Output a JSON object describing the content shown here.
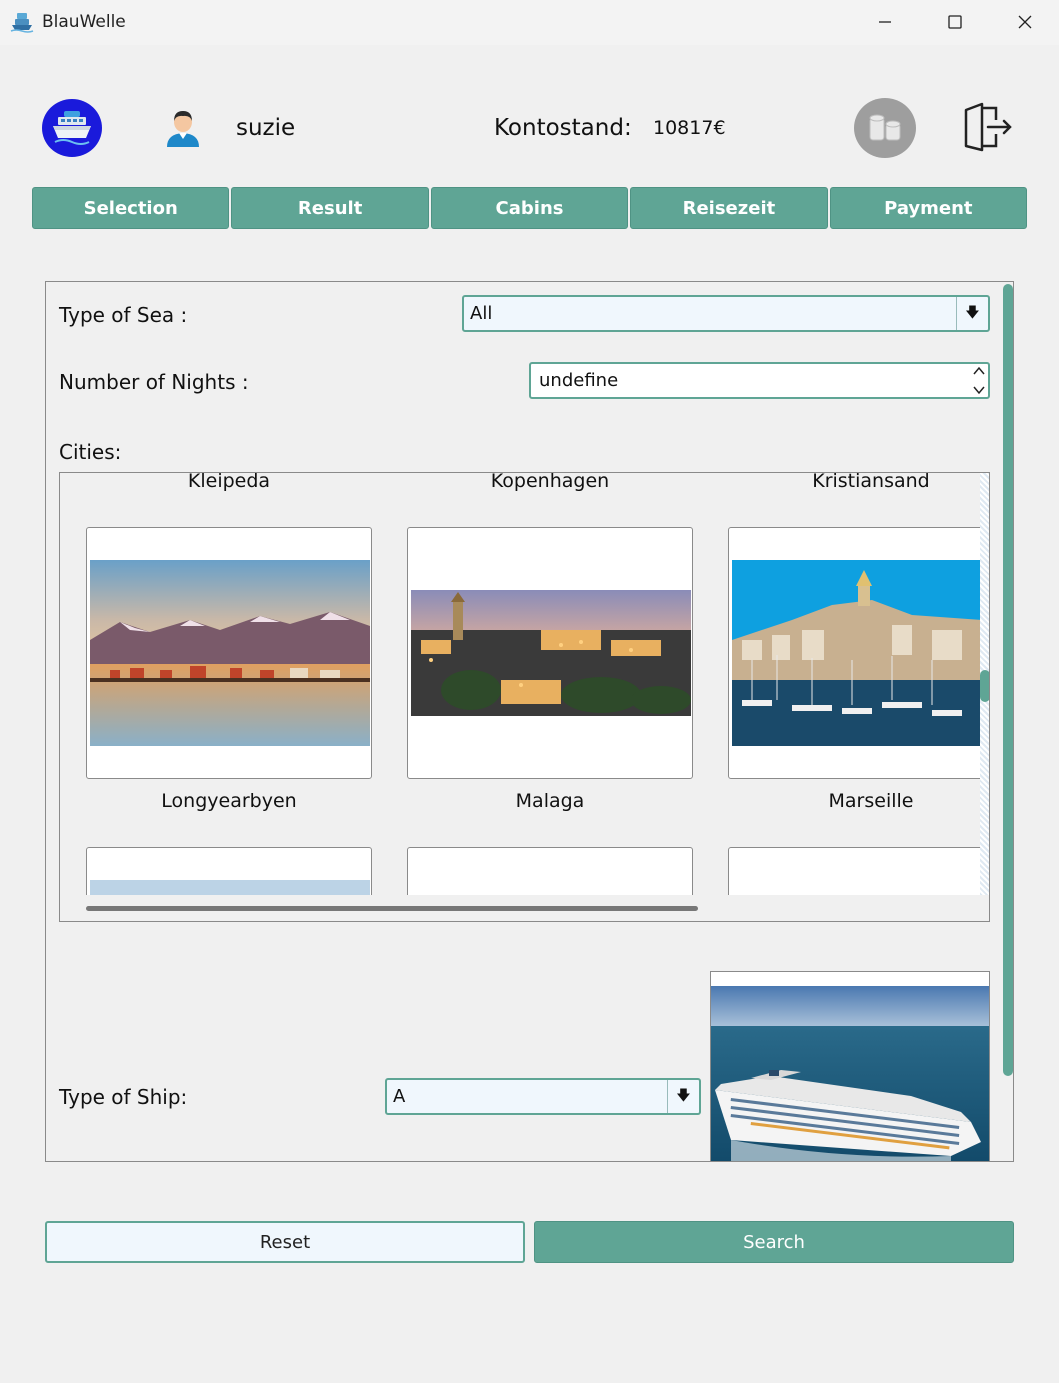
{
  "window": {
    "title": "BlauWelle"
  },
  "header": {
    "username": "suzie",
    "balance_label": "Kontostand:",
    "balance_value": "10817€"
  },
  "tabs": [
    {
      "label": "Selection"
    },
    {
      "label": "Result"
    },
    {
      "label": "Cabins"
    },
    {
      "label": "Reisezeit"
    },
    {
      "label": "Payment"
    }
  ],
  "form": {
    "sea_label": "Type of Sea :",
    "sea_value": "All",
    "nights_label": "Number of Nights :",
    "nights_value": "undefine",
    "cities_label": "Cities:",
    "ship_label": "Type of Ship:",
    "ship_value": "A"
  },
  "cities": {
    "top_row": [
      "Kleipeda",
      "Kopenhagen",
      "Kristiansand"
    ],
    "middle_row": [
      "Longyearbyen",
      "Malaga",
      "Marseille"
    ]
  },
  "actions": {
    "reset_label": "Reset",
    "search_label": "Search"
  },
  "colors": {
    "accent": "#5fa595",
    "input_bg": "#f0f7fd",
    "window_bg": "#f0f0f0"
  },
  "icons": {
    "app": "ship-icon",
    "logo": "cruise-ship-logo-icon",
    "user": "user-avatar-icon",
    "coins": "coins-icon",
    "logout": "logout-door-icon",
    "dropdown": "arrow-down-icon",
    "spinner": "chevron-up-down-icon"
  }
}
